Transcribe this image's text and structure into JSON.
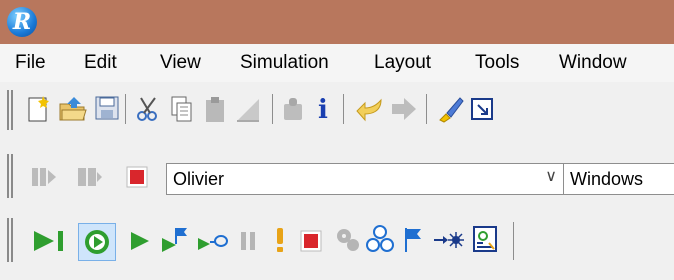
{
  "app": {
    "logo_letter": "R"
  },
  "menu": {
    "items": [
      "File",
      "Edit",
      "View",
      "Simulation",
      "Layout",
      "Tools",
      "Window"
    ]
  },
  "toolbar_main": {
    "icons": [
      "new-file-icon",
      "open-folder-icon",
      "save-icon",
      "cut-icon",
      "copy-icon",
      "paste-icon",
      "edit-pen-icon",
      "stamp-icon",
      "info-icon",
      "undo-icon",
      "redo-icon",
      "brush-icon",
      "maximize-icon"
    ]
  },
  "toolbar_config": {
    "project_value": "Olivier",
    "target_value": "Windows",
    "colors": {
      "stop": "#d9262c"
    }
  },
  "toolbar_sim": {
    "icons": [
      "step-to-end-icon",
      "run-icon",
      "play-icon",
      "play-flags-icon",
      "play-probe-icon",
      "pause-icon",
      "alert-icon",
      "stop-icon",
      "settings-icon",
      "components-icon",
      "flag-icon",
      "step-into-icon",
      "inspector-icon"
    ],
    "colors": {
      "green": "#2f9e2f",
      "stop": "#d9262c",
      "alert": "#e8a317",
      "blue": "#1f6fd1"
    }
  }
}
